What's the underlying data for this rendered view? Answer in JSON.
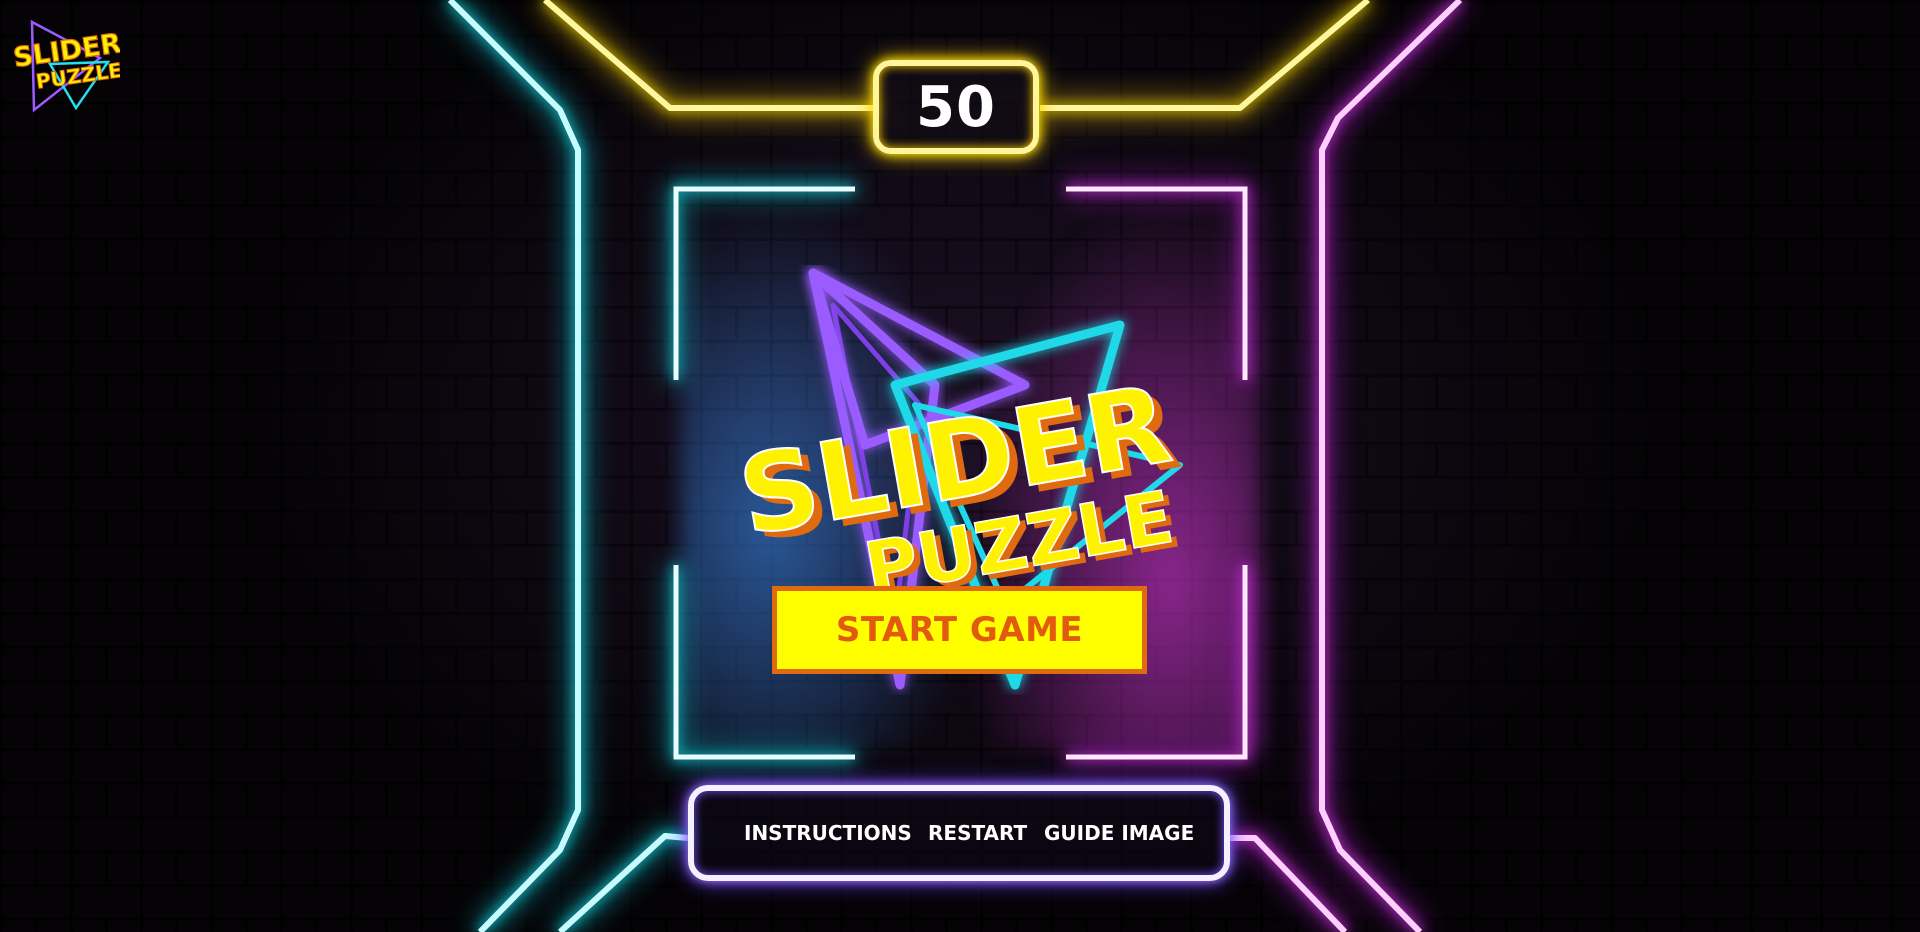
{
  "app": {
    "brand_logo_text": [
      "SLIDER",
      "PUZZLE"
    ]
  },
  "hud": {
    "score": "50"
  },
  "title_logo": {
    "line1": "SLIDER",
    "line2": "PUZZLE"
  },
  "start_button": {
    "label": "START GAME"
  },
  "menu": {
    "items": [
      {
        "label": "INSTRUCTIONS"
      },
      {
        "label": "RESTART"
      },
      {
        "label": "GUIDE IMAGE"
      }
    ]
  },
  "colors": {
    "neon_yellow": "#ffe400",
    "neon_cyan": "#17e6f0",
    "neon_magenta": "#e23df0",
    "neon_white": "#f4f0ff",
    "button_fill": "#ffff00",
    "button_text": "#e25a10",
    "logo_yellow": "#fff200",
    "logo_orange": "#e06a10"
  }
}
